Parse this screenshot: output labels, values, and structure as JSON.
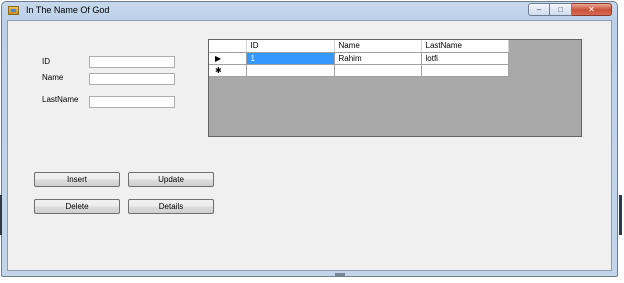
{
  "window": {
    "title": "In The Name Of God"
  },
  "caption_buttons": {
    "minimize": "–",
    "maximize": "□",
    "close": "✕"
  },
  "form": {
    "id_label": "ID",
    "name_label": "Name",
    "lastname_label": "LastName",
    "id_value": "",
    "name_value": "",
    "lastname_value": ""
  },
  "grid": {
    "columns": [
      "ID",
      "Name",
      "LastName"
    ],
    "rows": [
      {
        "indicator": "▶",
        "cells": [
          "1",
          "Rahim",
          "lotfi"
        ]
      },
      {
        "indicator": "✱",
        "cells": [
          "",
          "",
          ""
        ]
      }
    ],
    "selection_color": "#3399ff"
  },
  "buttons": {
    "insert": "Insert",
    "update": "Update",
    "delete": "Delete",
    "details": "Details"
  }
}
